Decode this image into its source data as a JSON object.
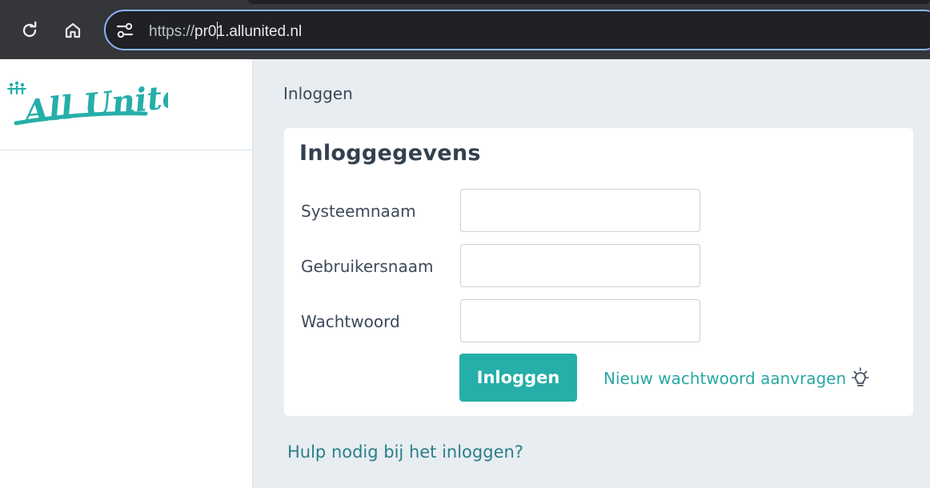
{
  "browser": {
    "url_scheme": "https://",
    "url_host_pre": "pr0",
    "url_host_post": "1.allunited.nl",
    "icons": [
      "reload-icon",
      "home-icon",
      "site-settings-icon"
    ]
  },
  "brand": {
    "logo_text": "All United",
    "logo_color": "#26aea9"
  },
  "breadcrumb": "Inloggen",
  "login_card": {
    "title": "Inloggegevens",
    "fields": [
      {
        "label": "Systeemnaam",
        "value": "",
        "placeholder": ""
      },
      {
        "label": "Gebruikersnaam",
        "value": "",
        "placeholder": ""
      },
      {
        "label": "Wachtwoord",
        "value": "",
        "placeholder": ""
      }
    ],
    "submit_label": "Inloggen",
    "reset_link": "Nieuw wachtwoord aanvragen",
    "reset_icon": "lightbulb-icon"
  },
  "help_link": "Hulp nodig bij het inloggen?",
  "colors": {
    "accent": "#26aea9",
    "page_bg": "#e8edf1",
    "text": "#3d4a5c"
  }
}
